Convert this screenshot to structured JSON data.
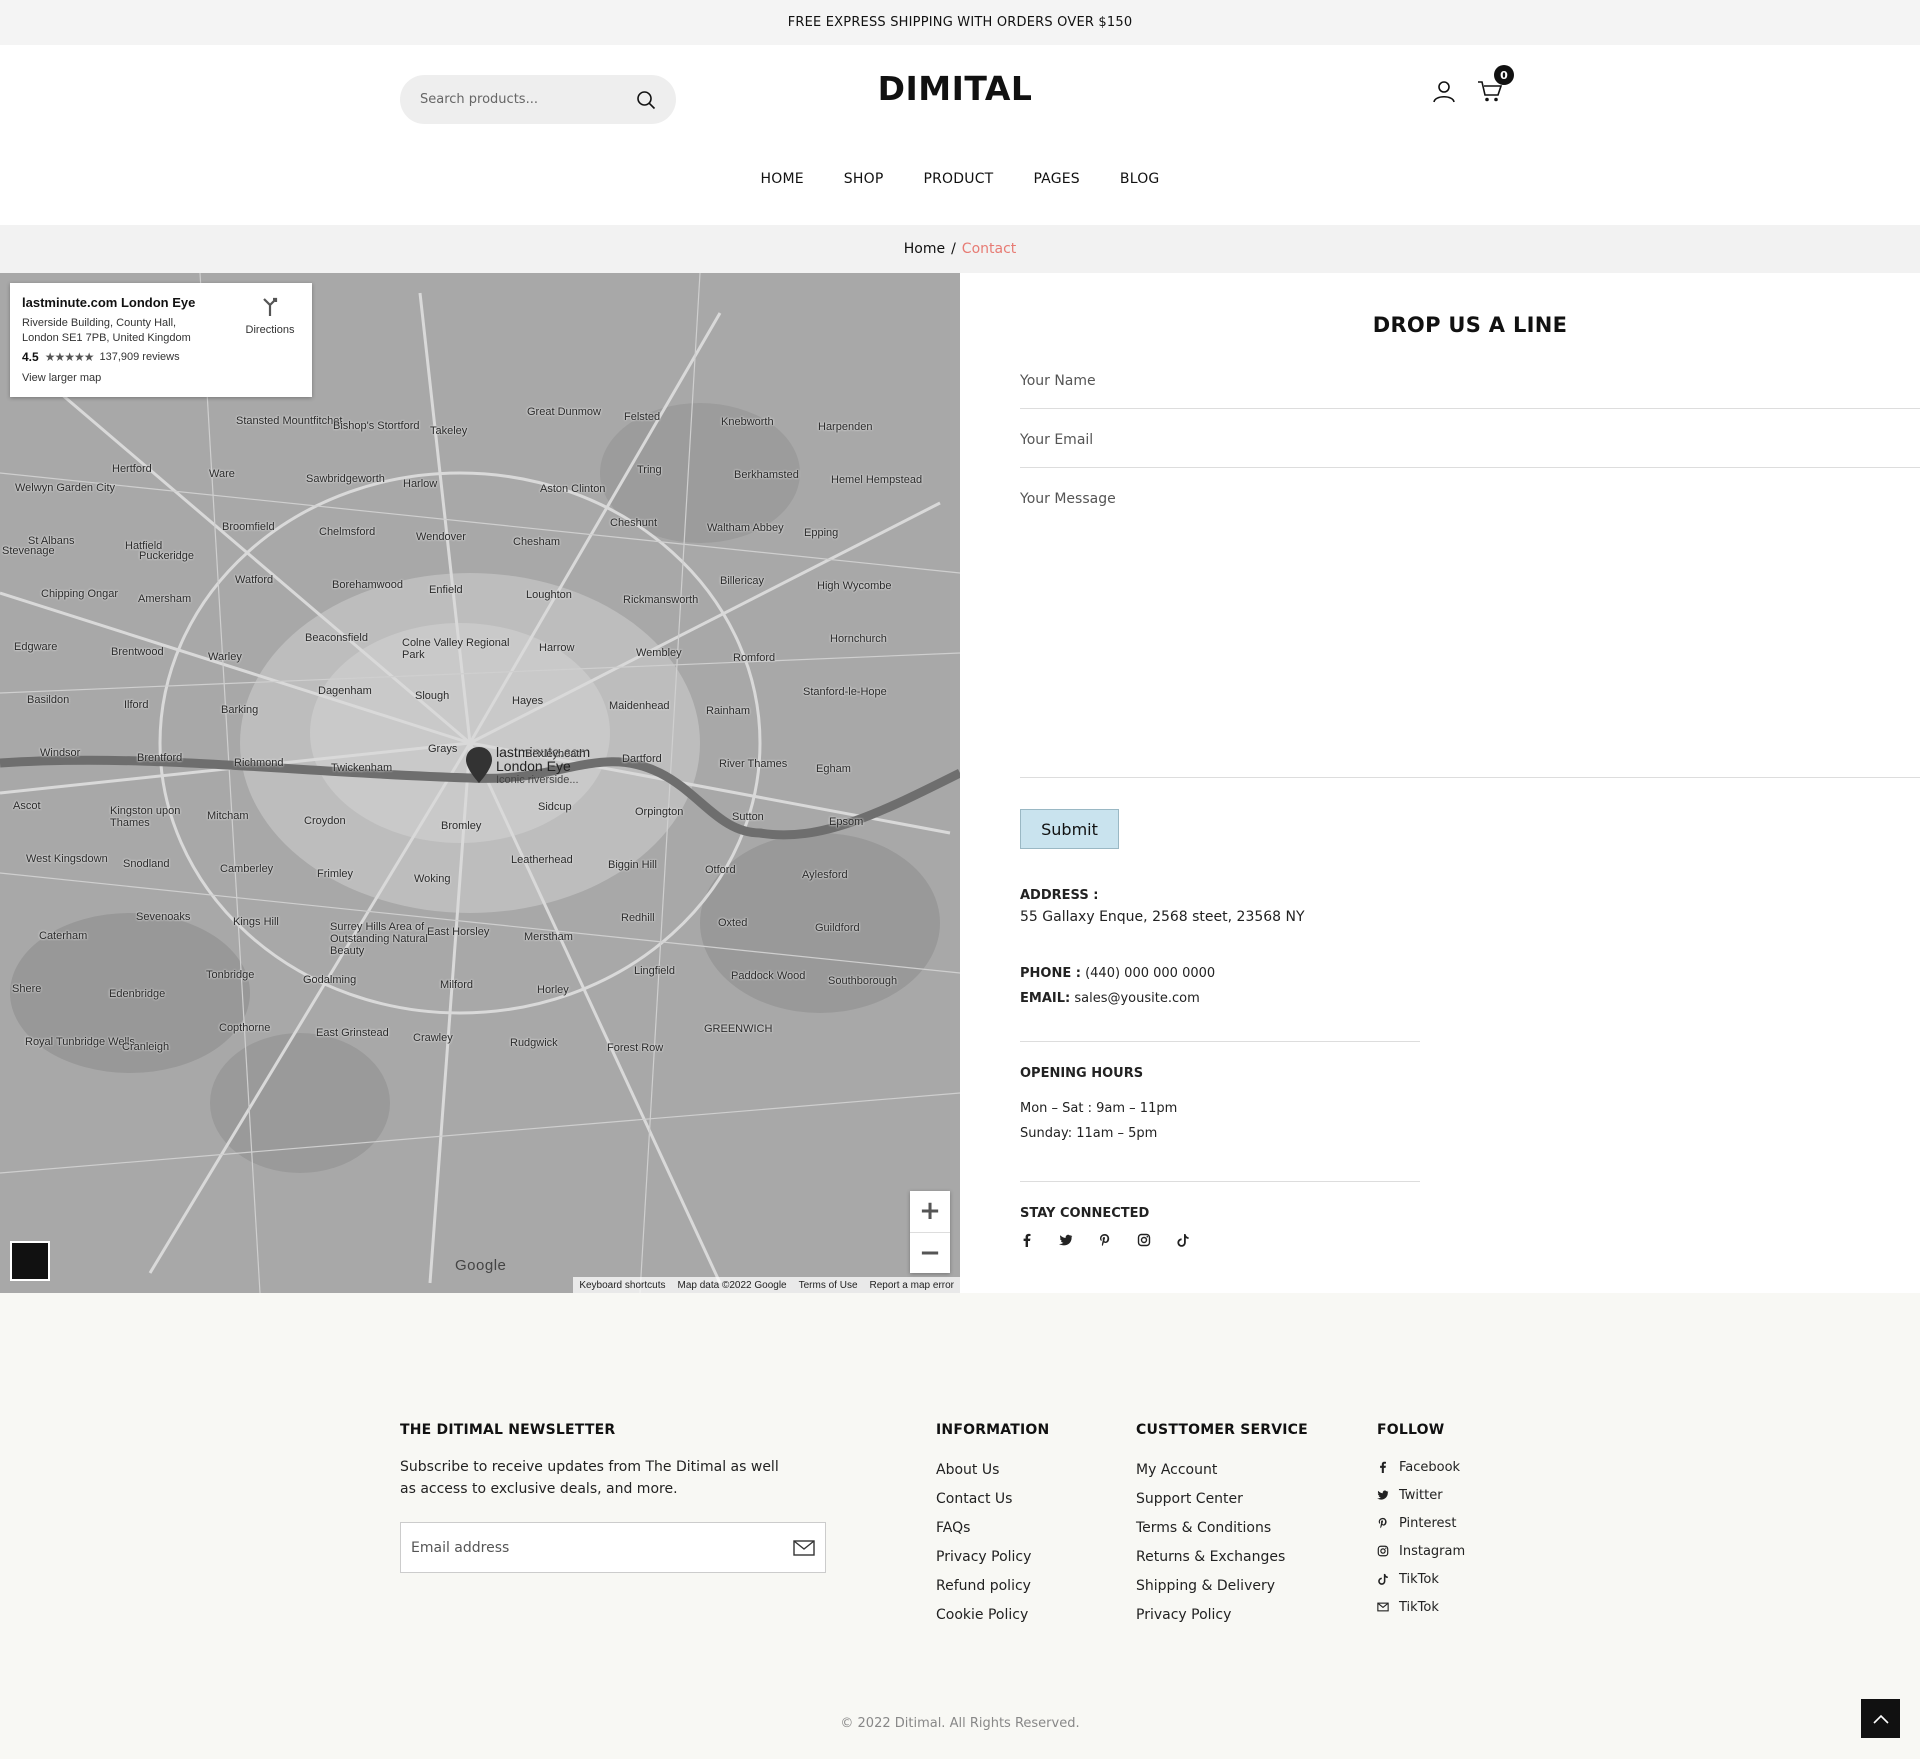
{
  "topbar": {
    "announcement": "FREE EXPRESS SHIPPING WITH ORDERS OVER $150"
  },
  "header": {
    "search_placeholder": "Search products...",
    "logo": "DIMITAL",
    "cart_count": "0"
  },
  "nav": {
    "items": [
      "HOME",
      "SHOP",
      "PRODUCT",
      "PAGES",
      "BLOG"
    ]
  },
  "breadcrumb": {
    "home": "Home",
    "separator": "/",
    "current": "Contact"
  },
  "map": {
    "place_name": "lastminute.com London Eye",
    "address": "Riverside Building, County Hall, London SE1 7PB, United Kingdom",
    "rating": "4.5",
    "stars": "★★★★★",
    "reviews": "137,909 reviews",
    "view_larger": "View larger map",
    "directions": "Directions",
    "pin_label_1": "lastminute.com",
    "pin_label_2": "London Eye",
    "pin_label_sub": "Iconic riverside...",
    "google_logo": "Google",
    "footer_links": [
      "Keyboard shortcuts",
      "Map data ©2022 Google",
      "Terms of Use",
      "Report a map error"
    ],
    "place_labels": [
      "Stevenage",
      "Puckeridge",
      "Stansted Mountfitchet",
      "Bishop's Stortford",
      "Takeley",
      "Great Dunmow",
      "Felsted",
      "Knebworth",
      "Harpenden",
      "Welwyn Garden City",
      "Hertford",
      "Ware",
      "Sawbridgeworth",
      "Harlow",
      "Aston Clinton",
      "Tring",
      "Berkhamsted",
      "Hemel Hempstead",
      "St Albans",
      "Hatfield",
      "Broomfield",
      "Chelmsford",
      "Wendover",
      "Chesham",
      "Cheshunt",
      "Waltham Abbey",
      "Epping",
      "Chipping Ongar",
      "Amersham",
      "Watford",
      "Borehamwood",
      "Enfield",
      "Loughton",
      "Rickmansworth",
      "Billericay",
      "High Wycombe",
      "Edgware",
      "Brentwood",
      "Warley",
      "Beaconsfield",
      "Colne Valley Regional Park",
      "Harrow",
      "Wembley",
      "Romford",
      "Hornchurch",
      "Basildon",
      "Ilford",
      "Barking",
      "Dagenham",
      "Slough",
      "Hayes",
      "Maidenhead",
      "Rainham",
      "Stanford-le-Hope",
      "Windsor",
      "Brentford",
      "Richmond",
      "Twickenham",
      "Grays",
      "Bexleyheath",
      "Dartford",
      "River Thames",
      "Egham",
      "Ascot",
      "Kingston upon Thames",
      "Mitcham",
      "Croydon",
      "Bromley",
      "Sidcup",
      "Orpington",
      "Sutton",
      "Epsom",
      "West Kingsdown",
      "Snodland",
      "Camberley",
      "Frimley",
      "Woking",
      "Leatherhead",
      "Biggin Hill",
      "Otford",
      "Aylesford",
      "Caterham",
      "Sevenoaks",
      "Kings Hill",
      "Surrey Hills Area of Outstanding Natural Beauty",
      "East Horsley",
      "Merstham",
      "Redhill",
      "Oxted",
      "Guildford",
      "Shere",
      "Edenbridge",
      "Tonbridge",
      "Godalming",
      "Milford",
      "Horley",
      "Lingfield",
      "Paddock Wood",
      "Southborough",
      "Royal Tunbridge Wells",
      "Cranleigh",
      "Copthorne",
      "East Grinstead",
      "Crawley",
      "Rudgwick",
      "Forest Row",
      "GREENWICH"
    ]
  },
  "contact": {
    "heading": "DROP US A LINE",
    "name_placeholder": "Your Name",
    "email_placeholder": "Your Email",
    "message_placeholder": "Your Message",
    "submit_label": "Submit",
    "address_label": "ADDRESS :",
    "address_value": "55 Gallaxy Enque, 2568 steet, 23568 NY",
    "phone_label": "PHONE :",
    "phone_value": "(440) 000 000 0000",
    "email_label": "EMAIL:",
    "email_value": "sales@yousite.com",
    "hours_title": "OPENING HOURS",
    "hours_weekday": "Mon – Sat : 9am – 11pm",
    "hours_sunday": "Sunday: 11am – 5pm",
    "stay_title": "STAY CONNECTED",
    "social_icons": [
      "facebook-icon",
      "twitter-icon",
      "pinterest-icon",
      "instagram-icon",
      "tiktok-icon"
    ]
  },
  "footer": {
    "newsletter_title": "THE DITIMAL NEWSLETTER",
    "newsletter_text": "Subscribe to receive updates from The Ditimal as well as access to exclusive deals, and more.",
    "newsletter_placeholder": "Email address",
    "info_title": "INFORMATION",
    "info_links": [
      "About Us",
      "Contact Us",
      "FAQs",
      "Privacy Policy",
      "Refund policy",
      "Cookie Policy"
    ],
    "service_title": "CUSTTOMER SERVICE",
    "service_links": [
      "My Account",
      "Support Center",
      "Terms & Conditions",
      "Returns & Exchanges",
      "Shipping & Delivery",
      "Privacy Policy"
    ],
    "follow_title": "FOLLOW",
    "follow_links": [
      "Facebook",
      "Twitter",
      "Pinterest",
      "Instagram",
      "TikTok",
      "TikTok"
    ],
    "copyright": "© 2022 Ditimal. All Rights Reserved."
  },
  "colors": {
    "accent": "#e77b74",
    "submit_bg": "#c9e3ee",
    "footer_bg": "#f8f8f4",
    "topbar_bg": "#f4f4f4"
  }
}
